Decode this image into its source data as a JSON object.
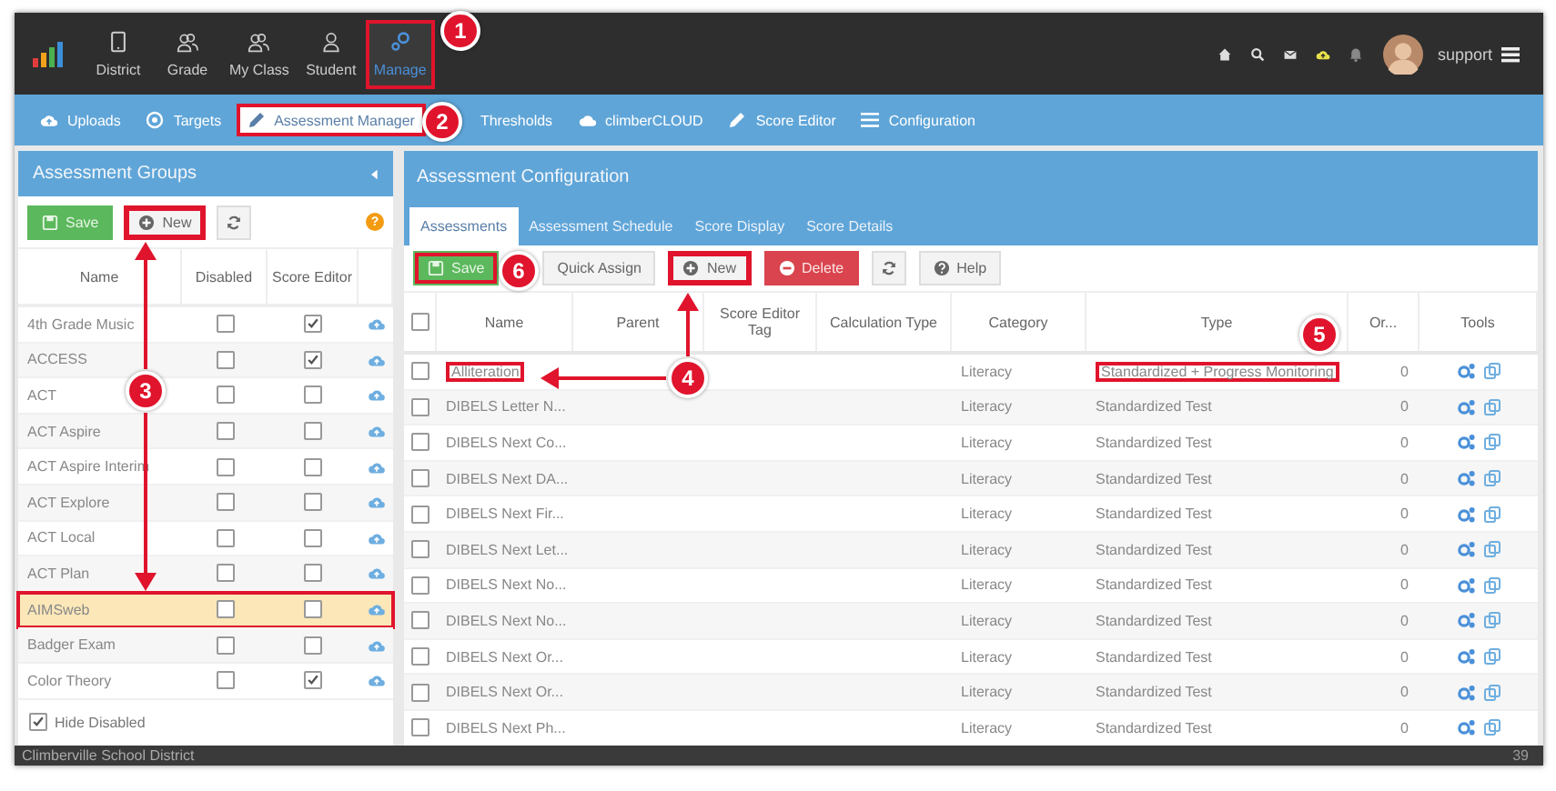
{
  "top_nav": {
    "items": [
      {
        "label": "District",
        "selected": false,
        "highlighted": false
      },
      {
        "label": "Grade",
        "selected": false,
        "highlighted": false
      },
      {
        "label": "My Class",
        "selected": false,
        "highlighted": false
      },
      {
        "label": "Student",
        "selected": false,
        "highlighted": false
      },
      {
        "label": "Manage",
        "selected": true,
        "highlighted": true
      }
    ],
    "user": "support"
  },
  "sub_nav": [
    {
      "label": "Uploads",
      "selected": false,
      "highlighted": false
    },
    {
      "label": "Targets",
      "selected": false,
      "highlighted": false
    },
    {
      "label": "Assessment Manager",
      "selected": true,
      "highlighted": true
    },
    {
      "label": "Thresholds",
      "selected": false,
      "highlighted": false
    },
    {
      "label": "climberCLOUD",
      "selected": false,
      "highlighted": false
    },
    {
      "label": "Score Editor",
      "selected": false,
      "highlighted": false
    },
    {
      "label": "Configuration",
      "selected": false,
      "highlighted": false
    }
  ],
  "assessment_groups": {
    "title": "Assessment Groups",
    "buttons": [
      {
        "kind": "save",
        "label": "Save",
        "highlighted": false
      },
      {
        "kind": "new",
        "label": "New",
        "highlighted": true
      },
      {
        "kind": "refresh",
        "highlighted": false
      }
    ],
    "help": "?",
    "columns": [
      "Name",
      "Disabled",
      "Score Editor"
    ],
    "rows": [
      {
        "name": "4th Grade Music",
        "disabled": false,
        "score_editor": true,
        "selected": false
      },
      {
        "name": "ACCESS",
        "disabled": false,
        "score_editor": true,
        "selected": false
      },
      {
        "name": "ACT",
        "disabled": false,
        "score_editor": false,
        "selected": false
      },
      {
        "name": "ACT Aspire",
        "disabled": false,
        "score_editor": false,
        "selected": false
      },
      {
        "name": "ACT Aspire Interim",
        "disabled": false,
        "score_editor": false,
        "selected": false
      },
      {
        "name": "ACT Explore",
        "disabled": false,
        "score_editor": false,
        "selected": false
      },
      {
        "name": "ACT Local",
        "disabled": false,
        "score_editor": false,
        "selected": false
      },
      {
        "name": "ACT Plan",
        "disabled": false,
        "score_editor": false,
        "selected": false
      },
      {
        "name": "AIMSweb",
        "disabled": false,
        "score_editor": false,
        "selected": true
      },
      {
        "name": "Badger Exam",
        "disabled": false,
        "score_editor": false,
        "selected": false
      },
      {
        "name": "Color Theory",
        "disabled": false,
        "score_editor": true,
        "selected": false
      }
    ],
    "hide_disabled": {
      "label": "Hide Disabled",
      "checked": true
    }
  },
  "assessment_configuration": {
    "title": "Assessment Configuration",
    "tabs": [
      {
        "label": "Assessments",
        "selected": true
      },
      {
        "label": "Assessment Schedule",
        "selected": false
      },
      {
        "label": "Score Display",
        "selected": false
      },
      {
        "label": "Score Details",
        "selected": false
      }
    ],
    "buttons": [
      {
        "kind": "save",
        "label": "Save",
        "highlighted": true
      },
      {
        "kind": "quick-assign",
        "label": "Quick Assign",
        "highlighted": false
      },
      {
        "kind": "new",
        "label": "New",
        "highlighted": true
      },
      {
        "kind": "delete",
        "label": "Delete",
        "highlighted": false
      },
      {
        "kind": "refresh",
        "highlighted": false
      },
      {
        "kind": "help",
        "label": "Help",
        "highlighted": false
      }
    ],
    "all_checked": false,
    "columns": [
      "Name",
      "Parent",
      "Score Editor Tag",
      "Calculation Type",
      "Category",
      "Type",
      "Or...",
      "Tools"
    ],
    "rows": [
      {
        "checked": false,
        "name": "Alliteration",
        "category": "Literacy",
        "type": "Standardized + Progress Monitoring",
        "order": "0",
        "name_highlighted": true,
        "type_highlighted": true
      },
      {
        "checked": false,
        "name": "DIBELS Letter N...",
        "category": "Literacy",
        "type": "Standardized Test",
        "order": "0",
        "name_highlighted": false,
        "type_highlighted": false
      },
      {
        "checked": false,
        "name": "DIBELS Next Co...",
        "category": "Literacy",
        "type": "Standardized Test",
        "order": "0",
        "name_highlighted": false,
        "type_highlighted": false
      },
      {
        "checked": false,
        "name": "DIBELS Next DA...",
        "category": "Literacy",
        "type": "Standardized Test",
        "order": "0",
        "name_highlighted": false,
        "type_highlighted": false
      },
      {
        "checked": false,
        "name": "DIBELS Next Fir...",
        "category": "Literacy",
        "type": "Standardized Test",
        "order": "0",
        "name_highlighted": false,
        "type_highlighted": false
      },
      {
        "checked": false,
        "name": "DIBELS Next Let...",
        "category": "Literacy",
        "type": "Standardized Test",
        "order": "0",
        "name_highlighted": false,
        "type_highlighted": false
      },
      {
        "checked": false,
        "name": "DIBELS Next No...",
        "category": "Literacy",
        "type": "Standardized Test",
        "order": "0",
        "name_highlighted": false,
        "type_highlighted": false
      },
      {
        "checked": false,
        "name": "DIBELS Next No...",
        "category": "Literacy",
        "type": "Standardized Test",
        "order": "0",
        "name_highlighted": false,
        "type_highlighted": false
      },
      {
        "checked": false,
        "name": "DIBELS Next Or...",
        "category": "Literacy",
        "type": "Standardized Test",
        "order": "0",
        "name_highlighted": false,
        "type_highlighted": false
      },
      {
        "checked": false,
        "name": "DIBELS Next Or...",
        "category": "Literacy",
        "type": "Standardized Test",
        "order": "0",
        "name_highlighted": false,
        "type_highlighted": false
      },
      {
        "checked": false,
        "name": "DIBELS Next Ph...",
        "category": "Literacy",
        "type": "Standardized Test",
        "order": "0",
        "name_highlighted": false,
        "type_highlighted": false
      }
    ]
  },
  "status_bar": {
    "text": "Climberville School District",
    "count": "39"
  },
  "callouts": [
    {
      "label": "1"
    },
    {
      "label": "2"
    },
    {
      "label": "3"
    },
    {
      "label": "4"
    },
    {
      "label": "5"
    },
    {
      "label": "6"
    }
  ]
}
